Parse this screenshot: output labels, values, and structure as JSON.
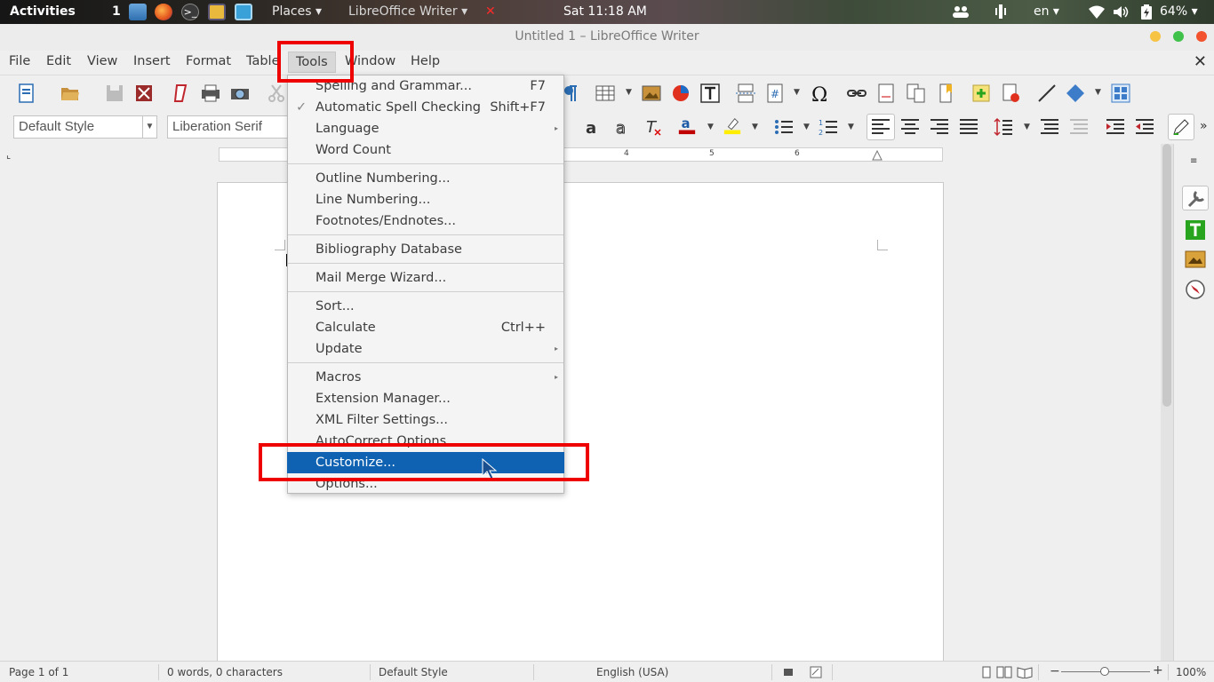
{
  "topbar": {
    "activities": "Activities",
    "workspace": "1",
    "places": "Places ▾",
    "active_app": "LibreOffice Writer ▾",
    "close_mark": "✕",
    "clock": "Sat 11:18 AM",
    "language": "en ▾",
    "battery": "64% ▾"
  },
  "window": {
    "title": "Untitled 1 – LibreOffice Writer"
  },
  "menubar": {
    "items": [
      "File",
      "Edit",
      "View",
      "Insert",
      "Format",
      "Table",
      "Tools",
      "Window",
      "Help"
    ],
    "close_doc": "✕"
  },
  "formatting": {
    "paragraph_style": "Default Style",
    "font_name": "Liberation Serif"
  },
  "ruler": {
    "labels": [
      "4",
      "5",
      "6"
    ]
  },
  "tools_menu": {
    "items": [
      {
        "label": "Spelling and Grammar...",
        "shortcut": "F7"
      },
      {
        "label": "Automatic Spell Checking",
        "shortcut": "Shift+F7",
        "checked": "✓"
      },
      {
        "label": "Language",
        "submenu": "▸"
      },
      {
        "label": "Word Count"
      },
      {
        "label": "Outline Numbering..."
      },
      {
        "label": "Line Numbering..."
      },
      {
        "label": "Footnotes/Endnotes..."
      },
      {
        "label": "Bibliography Database"
      },
      {
        "label": "Mail Merge Wizard..."
      },
      {
        "label": "Sort..."
      },
      {
        "label": "Calculate",
        "shortcut": "Ctrl++"
      },
      {
        "label": "Update",
        "submenu": "▸"
      },
      {
        "label": "Macros",
        "submenu": "▸"
      },
      {
        "label": "Extension Manager..."
      },
      {
        "label": "XML Filter Settings..."
      },
      {
        "label": "AutoCorrect Options"
      },
      {
        "label": "Customize..."
      },
      {
        "label": "Options..."
      }
    ],
    "highlighted": "Customize..."
  },
  "statusbar": {
    "page": "Page 1 of 1",
    "words": "0 words, 0 characters",
    "style": "Default Style",
    "language": "English (USA)",
    "zoom": "100%",
    "minus": "−",
    "plus": "+"
  },
  "colors": {
    "highlight": "#0f62b1",
    "annotation": "#ef0000",
    "font_color": "#c00000",
    "highlight_color": "#ffee00"
  }
}
